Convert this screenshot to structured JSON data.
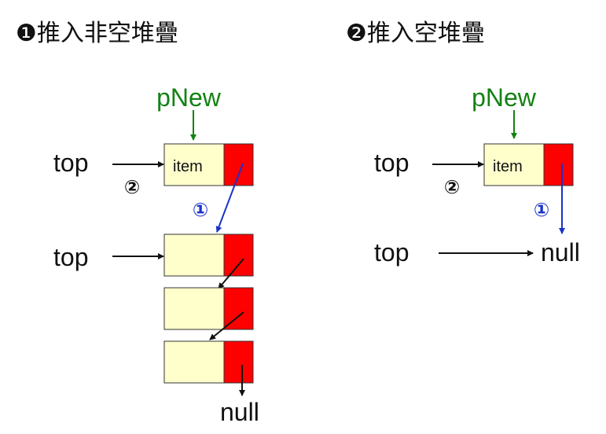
{
  "left": {
    "title": "❶推入非空堆疊",
    "pointer_label": "pNew",
    "top_label_new": "top",
    "top_label_old": "top",
    "item_label": "item",
    "step_link": "①",
    "step_top": "②",
    "null_label": "null"
  },
  "right": {
    "title": "❷推入空堆疊",
    "pointer_label": "pNew",
    "top_label_new": "top",
    "top_label_old": "top",
    "item_label": "item",
    "step_link": "①",
    "step_top": "②",
    "null_label": "null"
  },
  "colors": {
    "node_data": "#ffffcc",
    "node_link": "#ff0000",
    "pointer": "#138213",
    "new_link": "#1a33c8"
  }
}
